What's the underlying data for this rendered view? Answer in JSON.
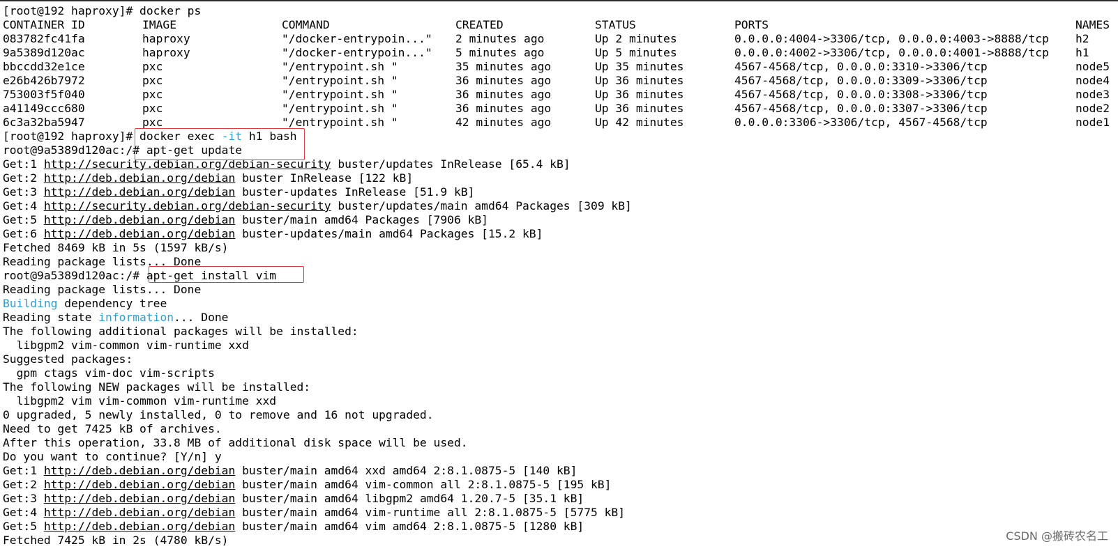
{
  "terminal": {
    "prompt_host": "[root@192 haproxy]# ",
    "cmd_ps": "docker ps",
    "headers": [
      "CONTAINER ID",
      "IMAGE",
      "COMMAND",
      "CREATED",
      "STATUS",
      "PORTS",
      "NAMES"
    ],
    "containers": [
      {
        "id": "083782fc41fa",
        "image": "haproxy",
        "command": "\"/docker-entrypoin...\"",
        "created": "2 minutes ago",
        "status": "Up 2 minutes",
        "ports": "0.0.0.0:4004->3306/tcp, 0.0.0.0:4003->8888/tcp",
        "names": "h2"
      },
      {
        "id": "9a5389d120ac",
        "image": "haproxy",
        "command": "\"/docker-entrypoin...\"",
        "created": "5 minutes ago",
        "status": "Up 5 minutes",
        "ports": "0.0.0.0:4002->3306/tcp, 0.0.0.0:4001->8888/tcp",
        "names": "h1"
      },
      {
        "id": "bbccdd32e1ce",
        "image": "pxc",
        "command": "\"/entrypoint.sh \"",
        "created": "35 minutes ago",
        "status": "Up 35 minutes",
        "ports": "4567-4568/tcp, 0.0.0.0:3310->3306/tcp",
        "names": "node5"
      },
      {
        "id": "e26b426b7972",
        "image": "pxc",
        "command": "\"/entrypoint.sh \"",
        "created": "36 minutes ago",
        "status": "Up 36 minutes",
        "ports": "4567-4568/tcp, 0.0.0.0:3309->3306/tcp",
        "names": "node4"
      },
      {
        "id": "753003f5f040",
        "image": "pxc",
        "command": "\"/entrypoint.sh \"",
        "created": "36 minutes ago",
        "status": "Up 36 minutes",
        "ports": "4567-4568/tcp, 0.0.0.0:3308->3306/tcp",
        "names": "node3"
      },
      {
        "id": "a41149ccc680",
        "image": "pxc",
        "command": "\"/entrypoint.sh \"",
        "created": "36 minutes ago",
        "status": "Up 36 minutes",
        "ports": "4567-4568/tcp, 0.0.0.0:3307->3306/tcp",
        "names": "node2"
      },
      {
        "id": "6c3a32ba5947",
        "image": "pxc",
        "command": "\"/entrypoint.sh \"",
        "created": "42 minutes ago",
        "status": "Up 42 minutes",
        "ports": "0.0.0.0:3306->3306/tcp, 4567-4568/tcp",
        "names": "node1"
      }
    ],
    "cmd_exec_a": "docker exec ",
    "cmd_exec_flag": "-it",
    "cmd_exec_b": " h1 bash",
    "prompt_container": "root@9a5389d120ac:/# ",
    "cmd_update": "apt-get update",
    "update_lines": [
      {
        "prefix": "Get:1 ",
        "url": "http://security.debian.org/debian-security",
        "rest": " buster/updates InRelease [65.4 kB]"
      },
      {
        "prefix": "Get:2 ",
        "url": "http://deb.debian.org/debian",
        "rest": " buster InRelease [122 kB]"
      },
      {
        "prefix": "Get:3 ",
        "url": "http://deb.debian.org/debian",
        "rest": " buster-updates InRelease [51.9 kB]"
      },
      {
        "prefix": "Get:4 ",
        "url": "http://security.debian.org/debian-security",
        "rest": " buster/updates/main amd64 Packages [309 kB]"
      },
      {
        "prefix": "Get:5 ",
        "url": "http://deb.debian.org/debian",
        "rest": " buster/main amd64 Packages [7906 kB]"
      },
      {
        "prefix": "Get:6 ",
        "url": "http://deb.debian.org/debian",
        "rest": " buster-updates/main amd64 Packages [15.2 kB]"
      }
    ],
    "fetched_update": "Fetched 8469 kB in 5s (1597 kB/s)",
    "reading_lists": "Reading package lists... Done",
    "cmd_install": "apt-get install vim",
    "reading_lists_2": "Reading package lists... Done",
    "building_word": "Building",
    "building_rest": " dependency tree",
    "reading_state_a": "Reading state ",
    "reading_state_word": "information",
    "reading_state_b": "... Done",
    "additional_header": "The following additional packages will be installed:",
    "additional_list": "  libgpm2 vim-common vim-runtime xxd",
    "suggested_header": "Suggested packages:",
    "suggested_list": "  gpm ctags vim-doc vim-scripts",
    "new_header": "The following NEW packages will be installed:",
    "new_list": "  libgpm2 vim vim-common vim-runtime xxd",
    "upgrade_summary": "0 upgraded, 5 newly installed, 0 to remove and 16 not upgraded.",
    "need_get": "Need to get 7425 kB of archives.",
    "after_op": "After this operation, 33.8 MB of additional disk space will be used.",
    "continue_prompt": "Do you want to continue? [Y/n] y",
    "install_lines": [
      {
        "prefix": "Get:1 ",
        "url": "http://deb.debian.org/debian",
        "rest": " buster/main amd64 xxd amd64 2:8.1.0875-5 [140 kB]"
      },
      {
        "prefix": "Get:2 ",
        "url": "http://deb.debian.org/debian",
        "rest": " buster/main amd64 vim-common all 2:8.1.0875-5 [195 kB]"
      },
      {
        "prefix": "Get:3 ",
        "url": "http://deb.debian.org/debian",
        "rest": " buster/main amd64 libgpm2 amd64 1.20.7-5 [35.1 kB]"
      },
      {
        "prefix": "Get:4 ",
        "url": "http://deb.debian.org/debian",
        "rest": " buster/main amd64 vim-runtime all 2:8.1.0875-5 [5775 kB]"
      },
      {
        "prefix": "Get:5 ",
        "url": "http://deb.debian.org/debian",
        "rest": " buster/main amd64 vim amd64 2:8.1.0875-5 [1280 kB]"
      }
    ],
    "fetched_install": "Fetched 7425 kB in 2s (4780 kB/s)"
  },
  "watermark": "CSDN @搬砖农名工",
  "colors": {
    "highlight_box": "#e03a3a",
    "info_blue": "#2f9fd3"
  }
}
